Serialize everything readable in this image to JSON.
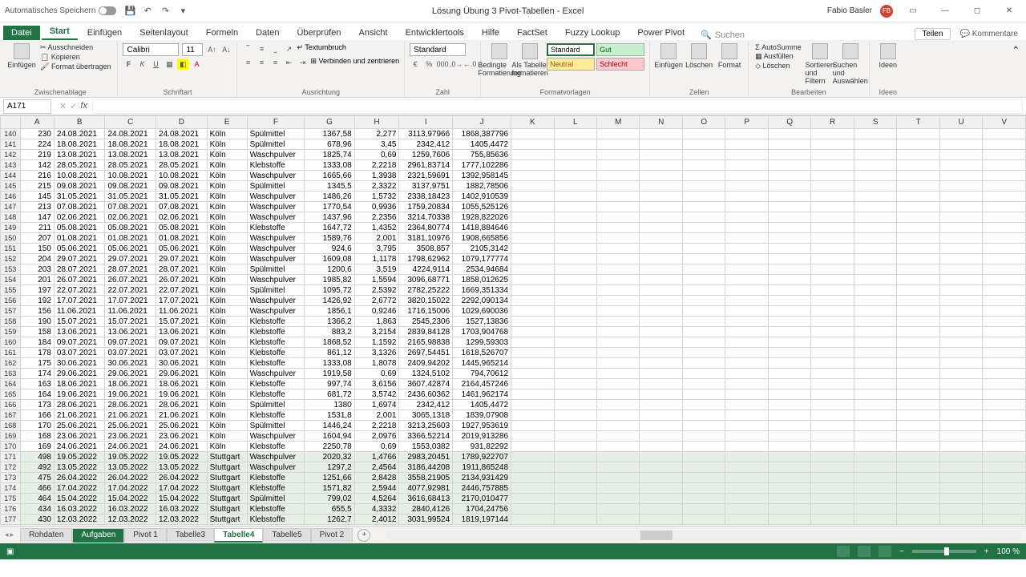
{
  "titlebar": {
    "autosave": "Automatisches Speichern",
    "doc_title": "Lösung Übung 3 Pivot-Tabellen  -  Excel",
    "user_name": "Fabio Basler",
    "user_initials": "FB"
  },
  "tabs": {
    "file": "Datei",
    "items": [
      "Start",
      "Einfügen",
      "Seitenlayout",
      "Formeln",
      "Daten",
      "Überprüfen",
      "Ansicht",
      "Entwicklertools",
      "Hilfe",
      "FactSet",
      "Fuzzy Lookup",
      "Power Pivot"
    ],
    "active": "Start",
    "search_placeholder": "Suchen",
    "share": "Teilen",
    "comments": "Kommentare"
  },
  "ribbon": {
    "paste": "Einfügen",
    "cut": "Ausschneiden",
    "copy": "Kopieren",
    "format_painter": "Format übertragen",
    "clipboard_label": "Zwischenablage",
    "font_name": "Calibri",
    "font_size": "11",
    "font_label": "Schriftart",
    "wrap": "Textumbruch",
    "merge": "Verbinden und zentrieren",
    "align_label": "Ausrichtung",
    "number_format": "Standard",
    "number_label": "Zahl",
    "cond_format": "Bedingte Formatierung",
    "as_table": "Als Tabelle formatieren",
    "styles": {
      "standard": "Standard",
      "gut": "Gut",
      "neutral": "Neutral",
      "schlecht": "Schlecht"
    },
    "styles_label": "Formatvorlagen",
    "insert": "Einfügen",
    "delete": "Löschen",
    "format": "Format",
    "cells_label": "Zellen",
    "autosum": "AutoSumme",
    "fill": "Ausfüllen",
    "clear": "Löschen",
    "sort_filter": "Sortieren und Filtern",
    "find": "Suchen und Auswählen",
    "edit_label": "Bearbeiten",
    "ideas": "Ideen",
    "ideas_label": "Ideen"
  },
  "namebox": "A171",
  "columns": [
    "A",
    "B",
    "C",
    "D",
    "E",
    "F",
    "G",
    "H",
    "I",
    "J",
    "K",
    "L",
    "M",
    "N",
    "O",
    "P",
    "Q",
    "R",
    "S",
    "T",
    "U",
    "V"
  ],
  "rows": [
    {
      "n": 140,
      "a": 230,
      "b": "24.08.2021",
      "c": "24.08.2021",
      "d": "24.08.2021",
      "e": "Köln",
      "f": "Spülmittel",
      "g": "1367,58",
      "h": "2,277",
      "i": "3113,97966",
      "j": "1868,387796"
    },
    {
      "n": 141,
      "a": 224,
      "b": "18.08.2021",
      "c": "18.08.2021",
      "d": "18.08.2021",
      "e": "Köln",
      "f": "Spülmittel",
      "g": "678,96",
      "h": "3,45",
      "i": "2342,412",
      "j": "1405,4472"
    },
    {
      "n": 142,
      "a": 219,
      "b": "13.08.2021",
      "c": "13.08.2021",
      "d": "13.08.2021",
      "e": "Köln",
      "f": "Waschpulver",
      "g": "1825,74",
      "h": "0,69",
      "i": "1259,7606",
      "j": "755,85636"
    },
    {
      "n": 143,
      "a": 142,
      "b": "28.05.2021",
      "c": "28.05.2021",
      "d": "28.05.2021",
      "e": "Köln",
      "f": "Klebstoffe",
      "g": "1333,08",
      "h": "2,2218",
      "i": "2961,83714",
      "j": "1777,102286"
    },
    {
      "n": 144,
      "a": 216,
      "b": "10.08.2021",
      "c": "10.08.2021",
      "d": "10.08.2021",
      "e": "Köln",
      "f": "Waschpulver",
      "g": "1665,66",
      "h": "1,3938",
      "i": "2321,59691",
      "j": "1392,958145"
    },
    {
      "n": 145,
      "a": 215,
      "b": "09.08.2021",
      "c": "09.08.2021",
      "d": "09.08.2021",
      "e": "Köln",
      "f": "Spülmittel",
      "g": "1345,5",
      "h": "2,3322",
      "i": "3137,9751",
      "j": "1882,78506"
    },
    {
      "n": 146,
      "a": 145,
      "b": "31.05.2021",
      "c": "31.05.2021",
      "d": "31.05.2021",
      "e": "Köln",
      "f": "Waschpulver",
      "g": "1486,26",
      "h": "1,5732",
      "i": "2338,18423",
      "j": "1402,910539"
    },
    {
      "n": 147,
      "a": 213,
      "b": "07.08.2021",
      "c": "07.08.2021",
      "d": "07.08.2021",
      "e": "Köln",
      "f": "Waschpulver",
      "g": "1770,54",
      "h": "0,9936",
      "i": "1759,20834",
      "j": "1055,525126"
    },
    {
      "n": 148,
      "a": 147,
      "b": "02.06.2021",
      "c": "02.06.2021",
      "d": "02.06.2021",
      "e": "Köln",
      "f": "Waschpulver",
      "g": "1437,96",
      "h": "2,2356",
      "i": "3214,70338",
      "j": "1928,822026"
    },
    {
      "n": 149,
      "a": 211,
      "b": "05.08.2021",
      "c": "05.08.2021",
      "d": "05.08.2021",
      "e": "Köln",
      "f": "Klebstoffe",
      "g": "1647,72",
      "h": "1,4352",
      "i": "2364,80774",
      "j": "1418,884646"
    },
    {
      "n": 150,
      "a": 207,
      "b": "01.08.2021",
      "c": "01.08.2021",
      "d": "01.08.2021",
      "e": "Köln",
      "f": "Waschpulver",
      "g": "1589,76",
      "h": "2,001",
      "i": "3181,10976",
      "j": "1908,665856"
    },
    {
      "n": 151,
      "a": 150,
      "b": "05.06.2021",
      "c": "05.06.2021",
      "d": "05.06.2021",
      "e": "Köln",
      "f": "Waschpulver",
      "g": "924,6",
      "h": "3,795",
      "i": "3508,857",
      "j": "2105,3142"
    },
    {
      "n": 152,
      "a": 204,
      "b": "29.07.2021",
      "c": "29.07.2021",
      "d": "29.07.2021",
      "e": "Köln",
      "f": "Waschpulver",
      "g": "1609,08",
      "h": "1,1178",
      "i": "1798,62962",
      "j": "1079,177774"
    },
    {
      "n": 153,
      "a": 203,
      "b": "28.07.2021",
      "c": "28.07.2021",
      "d": "28.07.2021",
      "e": "Köln",
      "f": "Spülmittel",
      "g": "1200,6",
      "h": "3,519",
      "i": "4224,9114",
      "j": "2534,94684"
    },
    {
      "n": 154,
      "a": 201,
      "b": "26.07.2021",
      "c": "26.07.2021",
      "d": "26.07.2021",
      "e": "Köln",
      "f": "Waschpulver",
      "g": "1985,82",
      "h": "1,5594",
      "i": "3096,68771",
      "j": "1858,012625"
    },
    {
      "n": 155,
      "a": 197,
      "b": "22.07.2021",
      "c": "22.07.2021",
      "d": "22.07.2021",
      "e": "Köln",
      "f": "Spülmittel",
      "g": "1095,72",
      "h": "2,5392",
      "i": "2782,25222",
      "j": "1669,351334"
    },
    {
      "n": 156,
      "a": 192,
      "b": "17.07.2021",
      "c": "17.07.2021",
      "d": "17.07.2021",
      "e": "Köln",
      "f": "Waschpulver",
      "g": "1426,92",
      "h": "2,6772",
      "i": "3820,15022",
      "j": "2292,090134"
    },
    {
      "n": 157,
      "a": 156,
      "b": "11.06.2021",
      "c": "11.06.2021",
      "d": "11.06.2021",
      "e": "Köln",
      "f": "Waschpulver",
      "g": "1856,1",
      "h": "0,9246",
      "i": "1716,15006",
      "j": "1029,690036"
    },
    {
      "n": 158,
      "a": 190,
      "b": "15.07.2021",
      "c": "15.07.2021",
      "d": "15.07.2021",
      "e": "Köln",
      "f": "Klebstoffe",
      "g": "1366,2",
      "h": "1,863",
      "i": "2545,2306",
      "j": "1527,13836"
    },
    {
      "n": 159,
      "a": 158,
      "b": "13.06.2021",
      "c": "13.06.2021",
      "d": "13.06.2021",
      "e": "Köln",
      "f": "Klebstoffe",
      "g": "883,2",
      "h": "3,2154",
      "i": "2839,84128",
      "j": "1703,904768"
    },
    {
      "n": 160,
      "a": 184,
      "b": "09.07.2021",
      "c": "09.07.2021",
      "d": "09.07.2021",
      "e": "Köln",
      "f": "Klebstoffe",
      "g": "1868,52",
      "h": "1,1592",
      "i": "2165,98838",
      "j": "1299,59303"
    },
    {
      "n": 161,
      "a": 178,
      "b": "03.07.2021",
      "c": "03.07.2021",
      "d": "03.07.2021",
      "e": "Köln",
      "f": "Klebstoffe",
      "g": "861,12",
      "h": "3,1326",
      "i": "2697,54451",
      "j": "1618,526707"
    },
    {
      "n": 162,
      "a": 175,
      "b": "30.06.2021",
      "c": "30.06.2021",
      "d": "30.06.2021",
      "e": "Köln",
      "f": "Klebstoffe",
      "g": "1333,08",
      "h": "1,8078",
      "i": "2409,94202",
      "j": "1445,965214"
    },
    {
      "n": 163,
      "a": 174,
      "b": "29.06.2021",
      "c": "29.06.2021",
      "d": "29.06.2021",
      "e": "Köln",
      "f": "Waschpulver",
      "g": "1919,58",
      "h": "0,69",
      "i": "1324,5102",
      "j": "794,70612"
    },
    {
      "n": 164,
      "a": 163,
      "b": "18.06.2021",
      "c": "18.06.2021",
      "d": "18.06.2021",
      "e": "Köln",
      "f": "Klebstoffe",
      "g": "997,74",
      "h": "3,6156",
      "i": "3607,42874",
      "j": "2164,457246"
    },
    {
      "n": 165,
      "a": 164,
      "b": "19.06.2021",
      "c": "19.06.2021",
      "d": "19.06.2021",
      "e": "Köln",
      "f": "Klebstoffe",
      "g": "681,72",
      "h": "3,5742",
      "i": "2436,60362",
      "j": "1461,962174"
    },
    {
      "n": 166,
      "a": 173,
      "b": "28.06.2021",
      "c": "28.06.2021",
      "d": "28.06.2021",
      "e": "Köln",
      "f": "Spülmittel",
      "g": "1380",
      "h": "1,6974",
      "i": "2342,412",
      "j": "1405,4472"
    },
    {
      "n": 167,
      "a": 166,
      "b": "21.06.2021",
      "c": "21.06.2021",
      "d": "21.06.2021",
      "e": "Köln",
      "f": "Klebstoffe",
      "g": "1531,8",
      "h": "2,001",
      "i": "3065,1318",
      "j": "1839,07908"
    },
    {
      "n": 168,
      "a": 170,
      "b": "25.06.2021",
      "c": "25.06.2021",
      "d": "25.06.2021",
      "e": "Köln",
      "f": "Spülmittel",
      "g": "1446,24",
      "h": "2,2218",
      "i": "3213,25603",
      "j": "1927,953619"
    },
    {
      "n": 169,
      "a": 168,
      "b": "23.06.2021",
      "c": "23.06.2021",
      "d": "23.06.2021",
      "e": "Köln",
      "f": "Waschpulver",
      "g": "1604,94",
      "h": "2,0976",
      "i": "3366,52214",
      "j": "2019,913286"
    },
    {
      "n": 170,
      "a": 169,
      "b": "24.06.2021",
      "c": "24.06.2021",
      "d": "24.06.2021",
      "e": "Köln",
      "f": "Klebstoffe",
      "g": "2250,78",
      "h": "0,69",
      "i": "1553,0382",
      "j": "931,82292"
    },
    {
      "n": 171,
      "a": 498,
      "b": "19.05.2022",
      "c": "19.05.2022",
      "d": "19.05.2022",
      "e": "Stuttgart",
      "f": "Waschpulver",
      "g": "2020,32",
      "h": "1,4766",
      "i": "2983,20451",
      "j": "1789,922707",
      "sel": true
    },
    {
      "n": 172,
      "a": 492,
      "b": "13.05.2022",
      "c": "13.05.2022",
      "d": "13.05.2022",
      "e": "Stuttgart",
      "f": "Waschpulver",
      "g": "1297,2",
      "h": "2,4564",
      "i": "3186,44208",
      "j": "1911,865248",
      "sel": true
    },
    {
      "n": 173,
      "a": 475,
      "b": "26.04.2022",
      "c": "26.04.2022",
      "d": "26.04.2022",
      "e": "Stuttgart",
      "f": "Klebstoffe",
      "g": "1251,66",
      "h": "2,8428",
      "i": "3558,21905",
      "j": "2134,931429",
      "sel": true
    },
    {
      "n": 174,
      "a": 466,
      "b": "17.04.2022",
      "c": "17.04.2022",
      "d": "17.04.2022",
      "e": "Stuttgart",
      "f": "Klebstoffe",
      "g": "1571,82",
      "h": "2,5944",
      "i": "4077,92981",
      "j": "2446,757885",
      "sel": true
    },
    {
      "n": 175,
      "a": 464,
      "b": "15.04.2022",
      "c": "15.04.2022",
      "d": "15.04.2022",
      "e": "Stuttgart",
      "f": "Spülmittel",
      "g": "799,02",
      "h": "4,5264",
      "i": "3616,68413",
      "j": "2170,010477",
      "sel": true
    },
    {
      "n": 176,
      "a": 434,
      "b": "16.03.2022",
      "c": "16.03.2022",
      "d": "16.03.2022",
      "e": "Stuttgart",
      "f": "Klebstoffe",
      "g": "655,5",
      "h": "4,3332",
      "i": "2840,4126",
      "j": "1704,24756",
      "sel": true
    },
    {
      "n": 177,
      "a": 430,
      "b": "12.03.2022",
      "c": "12.03.2022",
      "d": "12.03.2022",
      "e": "Stuttgart",
      "f": "Klebstoffe",
      "g": "1262,7",
      "h": "2,4012",
      "i": "3031,99524",
      "j": "1819,197144",
      "sel": true
    }
  ],
  "sheets": {
    "items": [
      "Rohdaten",
      "Aufgaben",
      "Pivot 1",
      "Tabelle3",
      "Tabelle4",
      "Tabelle5",
      "Pivot 2"
    ],
    "active_primary": "Aufgaben",
    "active_secondary": "Tabelle4"
  },
  "status": {
    "zoom": "100 %"
  }
}
